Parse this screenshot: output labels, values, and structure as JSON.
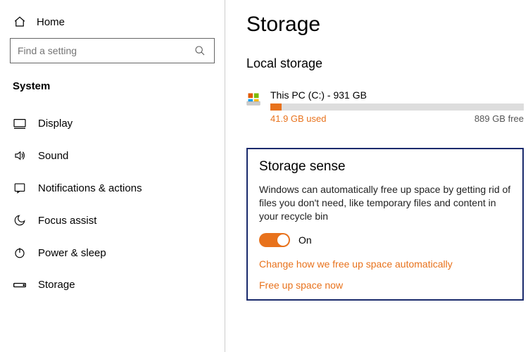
{
  "sidebar": {
    "home_label": "Home",
    "search_placeholder": "Find a setting",
    "section_title": "System",
    "items": [
      {
        "label": "Display"
      },
      {
        "label": "Sound"
      },
      {
        "label": "Notifications & actions"
      },
      {
        "label": "Focus assist"
      },
      {
        "label": "Power & sleep"
      },
      {
        "label": "Storage"
      }
    ]
  },
  "main": {
    "title": "Storage",
    "subhead": "Local storage",
    "drive": {
      "name": "This PC (C:) - 931 GB",
      "used_label": "41.9 GB used",
      "free_label": "889 GB free",
      "used_percent": 4.5
    },
    "sense": {
      "title": "Storage sense",
      "desc": "Windows can automatically free up space by getting rid of files you don't need, like temporary files and content in your recycle bin",
      "toggle_state": "On",
      "link_change": "Change how we free up space automatically",
      "link_freeup": "Free up space now"
    }
  },
  "colors": {
    "accent": "#e8721c",
    "box_border": "#1a2a6c"
  }
}
